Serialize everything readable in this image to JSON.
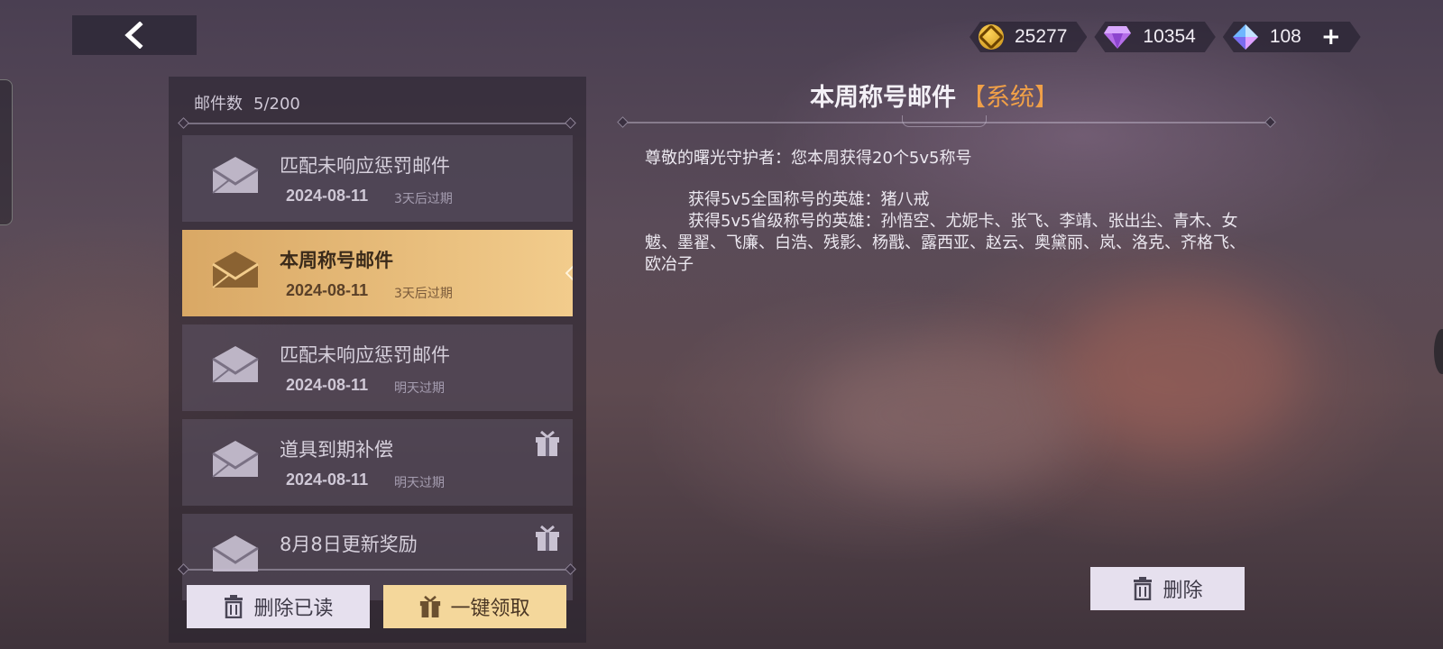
{
  "back": {
    "icon": "chevron-left-icon"
  },
  "currencies": [
    {
      "icon": "gold-coin-icon",
      "value": "25277"
    },
    {
      "icon": "purple-diamond-icon",
      "value": "10354"
    },
    {
      "icon": "blue-crystal-icon",
      "value": "108",
      "action": "+"
    }
  ],
  "mail_list": {
    "count_label": "邮件数",
    "count_value": "5/200",
    "items": [
      {
        "title": "匹配未响应惩罚邮件",
        "date": "2024-08-11",
        "expiry": "3天后过期",
        "selected": false,
        "has_gift": false
      },
      {
        "title": "本周称号邮件",
        "date": "2024-08-11",
        "expiry": "3天后过期",
        "selected": true,
        "has_gift": false
      },
      {
        "title": "匹配未响应惩罚邮件",
        "date": "2024-08-11",
        "expiry": "明天过期",
        "selected": false,
        "has_gift": false
      },
      {
        "title": "道具到期补偿",
        "date": "2024-08-11",
        "expiry": "明天过期",
        "selected": false,
        "has_gift": true
      },
      {
        "title": "8月8日更新奖励",
        "date": "",
        "expiry": "",
        "selected": false,
        "has_gift": true
      }
    ],
    "delete_read_label": "删除已读",
    "claim_all_label": "一键领取"
  },
  "detail": {
    "title": "本周称号邮件",
    "tag": "【系统】",
    "greeting": "尊敬的曙光守护者：您本周获得20个5v5称号",
    "line1": "获得5v5全国称号的英雄：猪八戒",
    "line2": "获得5v5省级称号的英雄：孙悟空、尤妮卡、张飞、李靖、张出尘、青木、女魃、墨翟、飞廉、白浩、残影、杨戬、露西亚、赵云、奥黛丽、岚、洛克、齐格飞、欧冶子",
    "delete_label": "删除"
  },
  "colors": {
    "accent_gold": "#f2cc8c",
    "tag_orange": "#f0a048"
  }
}
